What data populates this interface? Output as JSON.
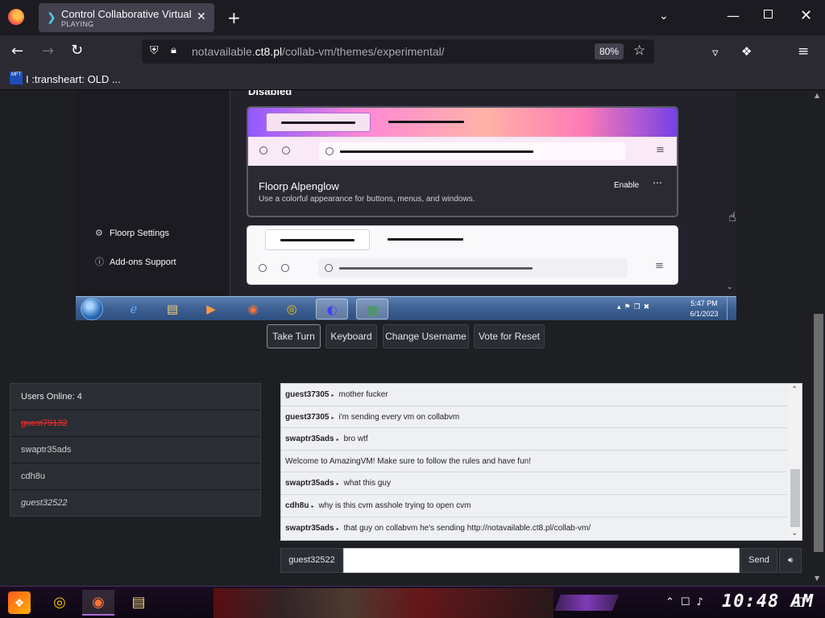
{
  "browser": {
    "tab": {
      "title": "Control Collaborative Virtual",
      "status": "PLAYING"
    },
    "url": {
      "prefix": "notavailable.",
      "domain": "ct8.pl",
      "path": "/collab-vm/themes/experimental/"
    },
    "zoom": "80%",
    "bookmark": {
      "icon_text": "MFT",
      "label": "I :transheart: OLD ..."
    }
  },
  "vm": {
    "sidebar": [
      {
        "label": "Floorp Settings",
        "icon": "gear-icon"
      },
      {
        "label": "Add-ons Support",
        "icon": "help-icon"
      }
    ],
    "section_heading": "Disabled",
    "theme": {
      "name": "Floorp Alpenglow",
      "description": "Use a colorful appearance for buttons, menus, and windows.",
      "enable_label": "Enable",
      "more_label": "⋯"
    },
    "taskbar": {
      "apps": [
        "windows-explorer-ie-icon",
        "folder-icon",
        "media-player-icon",
        "firefox-icon",
        "chrome-icon",
        "floorp-icon",
        "green-app-icon"
      ],
      "time": "5:47 PM",
      "date": "6/1/2023"
    }
  },
  "controls": {
    "take_turn": "Take Turn",
    "keyboard": "Keyboard",
    "change_username": "Change Username",
    "vote_reset": "Vote for Reset"
  },
  "users": {
    "header": "Users Online: 4",
    "list": [
      {
        "name": "guest79132",
        "color": "#ff2a2a",
        "style": "strike"
      },
      {
        "name": "swaptr35ads",
        "color": "#cfcfcf",
        "style": "normal"
      },
      {
        "name": "cdh8u",
        "color": "#cfcfcf",
        "style": "normal"
      },
      {
        "name": "guest32522",
        "color": "#cfcfcf",
        "style": "italic"
      }
    ]
  },
  "chat": {
    "messages": [
      {
        "user": "guest37305",
        "text": "mother fucker"
      },
      {
        "user": "guest37305",
        "text": "i'm sending every vm on collabvm"
      },
      {
        "user": "swaptr35ads",
        "text": "bro wtf"
      },
      {
        "user": "",
        "text": "Welcome to AmazingVM! Make sure to follow the rules and have fun!"
      },
      {
        "user": "swaptr35ads",
        "text": "what this guy"
      },
      {
        "user": "cdh8u",
        "text": "why is this cvm asshole trying to open cvm"
      },
      {
        "user": "swaptr35ads",
        "text": "that guy on collabvm he's sending http://notavailable.ct8.pl/collab-vm/"
      }
    ],
    "username": "guest32522",
    "input_value": "",
    "send_label": "Send"
  },
  "host_taskbar": {
    "clock": "10:48 AM"
  }
}
